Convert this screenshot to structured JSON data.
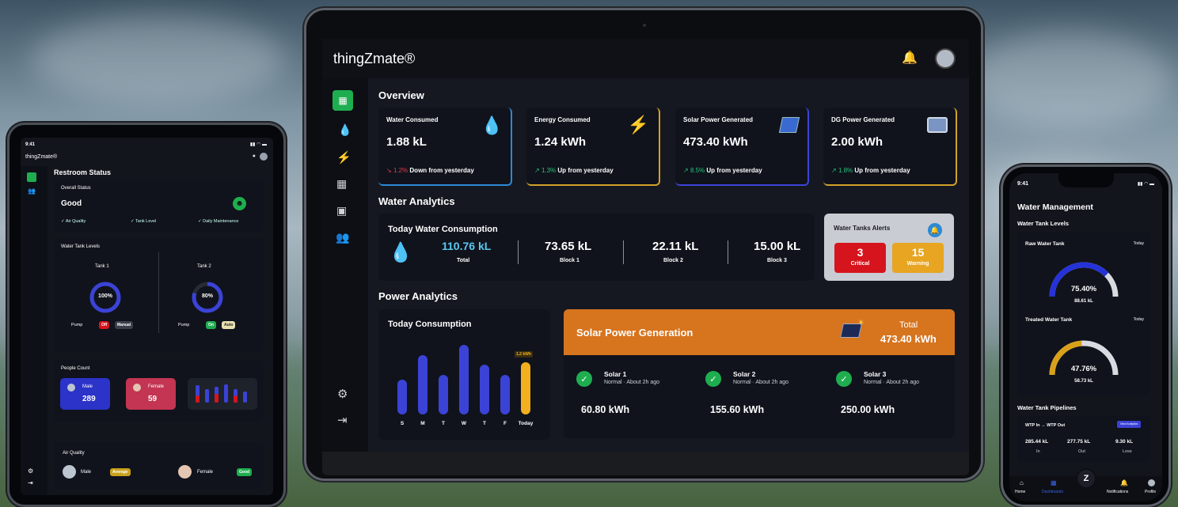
{
  "tablet": {
    "time": "9:41",
    "brand": "thingZmate®",
    "title": "Restroom Status",
    "overall": {
      "label": "Overall Status",
      "value": "Good",
      "checks": [
        "✓ Air Quality",
        "✓ Tank Level",
        "✓ Daily Maintenance"
      ]
    },
    "tanks": {
      "title": "Water Tank Levels",
      "items": [
        {
          "name": "Tank 1",
          "percent": "100%",
          "fraction": 1.0,
          "pump_label": "Pump",
          "state": "Off",
          "mode": "Manual"
        },
        {
          "name": "Tank 2",
          "percent": "80%",
          "fraction": 0.8,
          "pump_label": "Pump",
          "state": "On",
          "mode": "Auto"
        }
      ]
    },
    "people": {
      "title": "People Count",
      "male_label": "Male",
      "male_value": "289",
      "female_label": "Female",
      "female_value": "59"
    },
    "air": {
      "title": "Air Quality",
      "male_label": "Male",
      "male_status": "Average",
      "female_label": "Female",
      "female_status": "Good"
    }
  },
  "laptop": {
    "brand": "thingZmate®",
    "overview": {
      "title": "Overview",
      "cards": [
        {
          "title": "Water Consumed",
          "value": "1.88 kL",
          "pct": "1.2%",
          "trend": "Down from yesterday",
          "direction": "down",
          "icon": "water-drop-icon"
        },
        {
          "title": "Energy Consumed",
          "value": "1.24 kWh",
          "pct": "1.3%",
          "trend": "Up from yesterday",
          "direction": "up",
          "icon": "lightning-icon"
        },
        {
          "title": "Solar Power Generated",
          "value": "473.40 kWh",
          "pct": "8.5%",
          "trend": "Up from yesterday",
          "direction": "up",
          "icon": "solar-panel-icon"
        },
        {
          "title": "DG Power Generated",
          "value": "2.00 kWh",
          "pct": "1.8%",
          "trend": "Up from yesterday",
          "direction": "up",
          "icon": "generator-icon"
        }
      ]
    },
    "water_analytics": {
      "title": "Water Analytics",
      "today_title": "Today Water Consumption",
      "total_value": "110.76 kL",
      "total_label": "Total",
      "blocks": [
        {
          "value": "73.65 kL",
          "label": "Block 1"
        },
        {
          "value": "22.11 kL",
          "label": "Block 2"
        },
        {
          "value": "15.00 kL",
          "label": "Block 3"
        }
      ],
      "alerts_title": "Water Tanks Alerts",
      "critical_value": "3",
      "critical_label": "Critical",
      "warning_value": "15",
      "warning_label": "Warning"
    },
    "power_analytics": {
      "title": "Power Analytics",
      "today_title": "Today Consumption",
      "solar_title": "Solar Power Generation",
      "total_label": "Total",
      "total_value": "473.40 kWh",
      "solars": [
        {
          "name": "Solar 1",
          "status": "Normal · About 2h ago",
          "value": "60.80 kWh"
        },
        {
          "name": "Solar 2",
          "status": "Normal · About 2h ago",
          "value": "155.60 kWh"
        },
        {
          "name": "Solar 3",
          "status": "Normal · About 2h ago",
          "value": "250.00 kWh"
        }
      ]
    }
  },
  "chart_data": {
    "type": "bar",
    "title": "Today Consumption",
    "categories": [
      "S",
      "M",
      "T",
      "W",
      "T",
      "F",
      "Today"
    ],
    "values": [
      0.7,
      1.2,
      0.8,
      1.4,
      1.0,
      0.8,
      1.05
    ],
    "annotation": "1.2 kWh",
    "colors": {
      "default": "#3b43d6",
      "highlight": "#f2b01e"
    }
  },
  "phone": {
    "time": "9:41",
    "title": "Water Management",
    "levels_title": "Water Tank Levels",
    "raw": {
      "name": "Raw Water Tank",
      "tag": "Today",
      "percent": "75.40%",
      "volume": "88.61 kL",
      "fraction": 0.754
    },
    "treated": {
      "name": "Treated Water Tank",
      "tag": "Today",
      "percent": "47.76%",
      "volume": "58.73 kL",
      "fraction": 0.4776
    },
    "pipelines_title": "Water Tank Pipelines",
    "pipeline": {
      "route": "WTP In → WTP Out",
      "button": "View Analytics",
      "values": [
        {
          "value": "285.44 kL",
          "label": "In"
        },
        {
          "value": "277.75 kL",
          "label": "Out"
        },
        {
          "value": "9.30 kL",
          "label": "Loss"
        }
      ]
    },
    "nav": [
      "Home",
      "Dashboards",
      "Notifications",
      "Profile"
    ],
    "fab": "Z"
  },
  "colors": {
    "accent": "#1fae4f",
    "orange": "#d7741e",
    "blue": "#3b43d6",
    "critical": "#d6141d",
    "warning": "#e8a521"
  }
}
